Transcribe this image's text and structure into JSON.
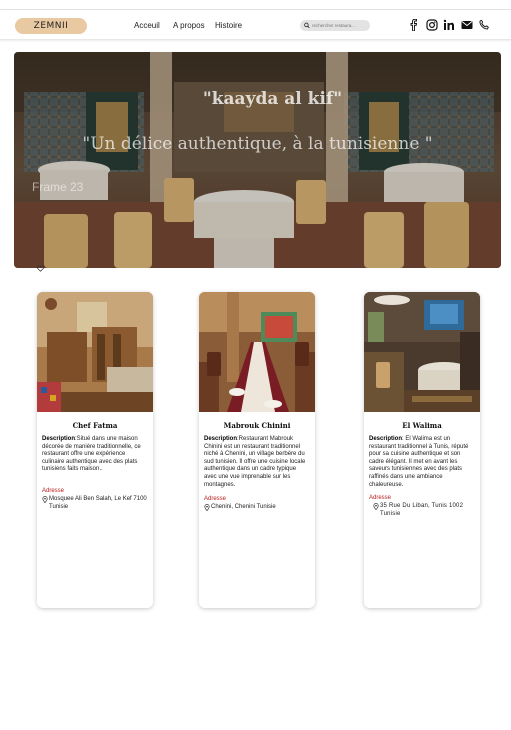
{
  "header": {
    "logo": "ZEMNII",
    "nav": [
      "Acceuil",
      "A propos",
      "Histoire"
    ],
    "search_placeholder": "rechercher restaura...",
    "social_icons": [
      "facebook-icon",
      "instagram-icon",
      "linkedin-icon",
      "mail-icon",
      "phone-icon"
    ]
  },
  "hero": {
    "title": "\"kaayda al kif\"",
    "subtitle": "\"Un délice authentique, à la tunisienne \"",
    "frame_label": "Frame 23"
  },
  "cards": [
    {
      "title": "Chef Fatma",
      "desc_label": "Description",
      "desc": ":Situé dans une maison décorée de manière traditionnelle, ce restaurant offre une expérience culinaire authentique avec des plats tunisiens faits maison..",
      "addr_label": "Adresse",
      "address": "Mosquee Ali Ben Salah, Le Kef 7100 Tunisie"
    },
    {
      "title": "Mabrouk Chinini",
      "desc_label": "Description",
      "desc": ":Restaurant Mabrouk Chinini est un restaurant traditionnel niché à Chenini, un village berbère du sud tunisien. Il offre une cuisine locale authentique dans un cadre typique avec une vue imprenable sur les montagnes.",
      "addr_label": "Adresse",
      "address": "Chenini, Chenini Tunisie"
    },
    {
      "title": "El Walima",
      "desc_label": "Description",
      "desc": ": El Walima est un restaurant traditionnel à Tunis, réputé pour sa cuisine authentique et son cadre élégant. Il met en avant les saveurs tunisiennes avec des plats raffinés dans une ambiance chaleureuse.",
      "addr_label": "Adresse",
      "address": "35 Rue Du Liban, Tunis 1002 Tunisie"
    }
  ],
  "colors": {
    "logo_bg": "#e9c9a2",
    "address_label": "#b81e1e"
  }
}
